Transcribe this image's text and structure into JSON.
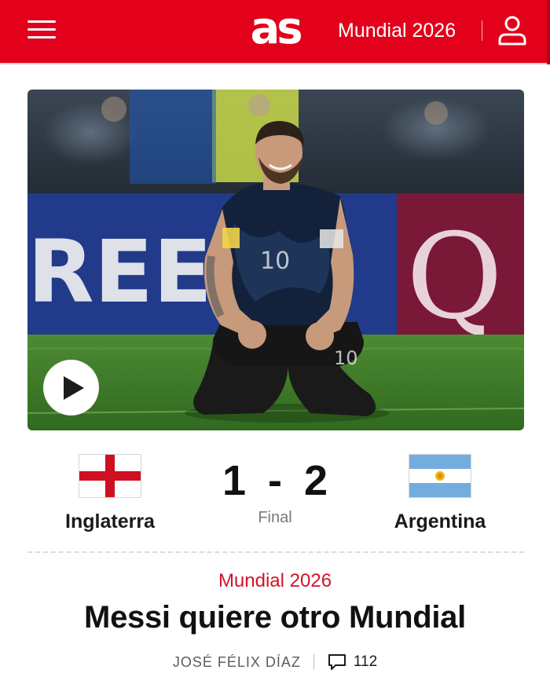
{
  "header": {
    "logo": "as",
    "section_link": "Mundial 2026",
    "icons": {
      "menu": "hamburger-menu-icon",
      "user": "user-profile-icon"
    },
    "colors": {
      "brand": "#e2001a"
    }
  },
  "hero": {
    "icons": {
      "play": "play-icon"
    }
  },
  "match": {
    "home": {
      "name": "Inglaterra",
      "flag": "england-flag-icon",
      "score": "1"
    },
    "away": {
      "name": "Argentina",
      "flag": "argentina-flag-icon",
      "score": "2"
    },
    "separator": "-",
    "status": "Final"
  },
  "article": {
    "kicker": "Mundial 2026",
    "headline": "Messi quiere otro Mundial",
    "author": "JOSÉ FÉLIX DÍAZ",
    "comments_count": "112",
    "colors": {
      "kicker": "#d3122a"
    }
  }
}
